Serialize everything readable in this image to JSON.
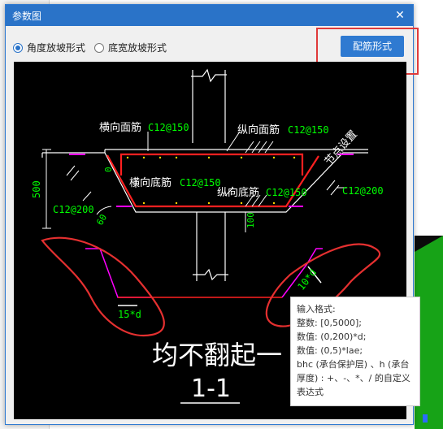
{
  "dialog": {
    "title": "参数图",
    "close_symbol": "✕",
    "options": [
      {
        "label": "角度放坡形式",
        "checked": true
      },
      {
        "label": "底宽放坡形式",
        "checked": false
      }
    ],
    "rebar_button": "配筋形式"
  },
  "drawing": {
    "top_bar_label": "横向面筋",
    "top_bar_spec": "C12@150",
    "long_top_label": "纵向面筋",
    "long_top_spec": "C12@150",
    "bottom_bar_label": "横向底筋",
    "bottom_bar_spec": "C12@150",
    "long_bottom_label": "纵向底筋",
    "long_bottom_spec": "C12@150",
    "side_left_spec": "C12@200",
    "side_right_spec": "C12@200",
    "node_setting": "节点设置",
    "dim_height": "500",
    "dim_zero": "0",
    "dim_angle": "60",
    "dim_pedestal": "100",
    "dim_anchor_left": "15*d",
    "dim_anchor_right": "10*d",
    "annotation_big": "均不翻起一",
    "section_label": "1-1"
  },
  "tooltip": {
    "lines": [
      "输入格式:",
      "整数: [0,5000];",
      "数值: (0,200)*d;",
      "数值: (0,5)*lae;",
      "bhc (承台保护层) 、h (承台厚度) : +、-、*、/ 的自定义表达式"
    ]
  },
  "colors": {
    "title_bar": "#2a73c8",
    "button": "#2f7ad1",
    "highlight": "#e03a3a",
    "canvas_bg": "#000000",
    "cad_green": "#00ff00",
    "cad_red": "#ff2020",
    "cad_magenta": "#ff00ff",
    "cad_white": "#ffffff"
  }
}
